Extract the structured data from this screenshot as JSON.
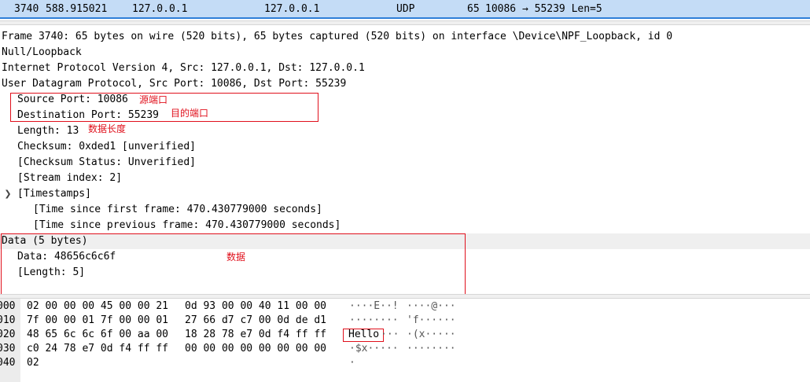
{
  "packet_list": {
    "row": {
      "no": "3740",
      "time": "588.915021",
      "source": "127.0.0.1",
      "destination": "127.0.0.1",
      "protocol": "UDP",
      "length": "65",
      "info": "10086 → 55239 Len=5"
    }
  },
  "details": {
    "frame": "Frame 3740: 65 bytes on wire (520 bits), 65 bytes captured (520 bits) on interface \\Device\\NPF_Loopback, id 0",
    "null_loopback": "Null/Loopback",
    "ipv4": "Internet Protocol Version 4, Src: 127.0.0.1, Dst: 127.0.0.1",
    "udp": "User Datagram Protocol, Src Port: 10086, Dst Port: 55239",
    "udp_fields": {
      "source_port": "Source Port: 10086",
      "destination_port": "Destination Port: 55239",
      "length": "Length: 13",
      "checksum": "Checksum: 0xded1 [unverified]",
      "checksum_status": "[Checksum Status: Unverified]",
      "stream_index": "[Stream index: 2]",
      "timestamps": "[Timestamps]",
      "time_first": "[Time since first frame: 470.430779000 seconds]",
      "time_prev": "[Time since previous frame: 470.430779000 seconds]"
    },
    "data": "Data (5 bytes)",
    "data_fields": {
      "data": "Data: 48656c6c6f",
      "length": "[Length: 5]"
    }
  },
  "annotations": {
    "source_port": "源端口",
    "destination_port": "目的端口",
    "length": "数据长度",
    "data": "数据"
  },
  "bytes": {
    "rows": [
      {
        "offset": "000",
        "hex1": "02 00 00 00 45 00 00 21",
        "hex2": "0d 93 00 00 40 11 00 00",
        "ascii1": "····E··!",
        "ascii2": "····@···"
      },
      {
        "offset": "010",
        "hex1": "7f 00 00 01 7f 00 00 01",
        "hex2": "27 66 d7 c7 00 0d de d1",
        "ascii1": "········",
        "ascii2": "'f······"
      },
      {
        "offset": "020",
        "hex1": "48 65 6c 6c 6f 00 aa 00",
        "hex2": "18 28 78 e7 0d f4 ff ff",
        "ascii1": "Hello",
        "ascii1b": "···",
        "ascii2": "·(x·····"
      },
      {
        "offset": "030",
        "hex1": "c0 24 78 e7 0d f4 ff ff",
        "hex2": "00 00 00 00 00 00 00 00",
        "ascii1": "·$x·····",
        "ascii2": "········"
      },
      {
        "offset": "040",
        "hex1": "02",
        "hex2": "",
        "ascii1": "·",
        "ascii2": ""
      }
    ]
  },
  "colors": {
    "selected_row_bg": "#c4dcf6",
    "annotation": "#e0101c"
  },
  "icons": {
    "expanded": "chevron-down-icon"
  }
}
